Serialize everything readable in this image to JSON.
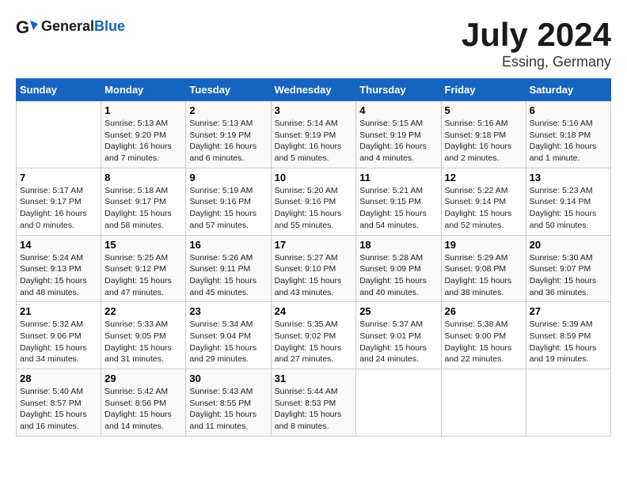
{
  "header": {
    "logo_text_general": "General",
    "logo_text_blue": "Blue",
    "month_title": "July 2024",
    "location": "Essing, Germany"
  },
  "calendar": {
    "days_of_week": [
      "Sunday",
      "Monday",
      "Tuesday",
      "Wednesday",
      "Thursday",
      "Friday",
      "Saturday"
    ],
    "weeks": [
      [
        {
          "day": "",
          "info": ""
        },
        {
          "day": "1",
          "info": "Sunrise: 5:13 AM\nSunset: 9:20 PM\nDaylight: 16 hours\nand 7 minutes."
        },
        {
          "day": "2",
          "info": "Sunrise: 5:13 AM\nSunset: 9:19 PM\nDaylight: 16 hours\nand 6 minutes."
        },
        {
          "day": "3",
          "info": "Sunrise: 5:14 AM\nSunset: 9:19 PM\nDaylight: 16 hours\nand 5 minutes."
        },
        {
          "day": "4",
          "info": "Sunrise: 5:15 AM\nSunset: 9:19 PM\nDaylight: 16 hours\nand 4 minutes."
        },
        {
          "day": "5",
          "info": "Sunrise: 5:16 AM\nSunset: 9:18 PM\nDaylight: 16 hours\nand 2 minutes."
        },
        {
          "day": "6",
          "info": "Sunrise: 5:16 AM\nSunset: 9:18 PM\nDaylight: 16 hours\nand 1 minute."
        }
      ],
      [
        {
          "day": "7",
          "info": "Sunrise: 5:17 AM\nSunset: 9:17 PM\nDaylight: 16 hours\nand 0 minutes."
        },
        {
          "day": "8",
          "info": "Sunrise: 5:18 AM\nSunset: 9:17 PM\nDaylight: 15 hours\nand 58 minutes."
        },
        {
          "day": "9",
          "info": "Sunrise: 5:19 AM\nSunset: 9:16 PM\nDaylight: 15 hours\nand 57 minutes."
        },
        {
          "day": "10",
          "info": "Sunrise: 5:20 AM\nSunset: 9:16 PM\nDaylight: 15 hours\nand 55 minutes."
        },
        {
          "day": "11",
          "info": "Sunrise: 5:21 AM\nSunset: 9:15 PM\nDaylight: 15 hours\nand 54 minutes."
        },
        {
          "day": "12",
          "info": "Sunrise: 5:22 AM\nSunset: 9:14 PM\nDaylight: 15 hours\nand 52 minutes."
        },
        {
          "day": "13",
          "info": "Sunrise: 5:23 AM\nSunset: 9:14 PM\nDaylight: 15 hours\nand 50 minutes."
        }
      ],
      [
        {
          "day": "14",
          "info": "Sunrise: 5:24 AM\nSunset: 9:13 PM\nDaylight: 15 hours\nand 48 minutes."
        },
        {
          "day": "15",
          "info": "Sunrise: 5:25 AM\nSunset: 9:12 PM\nDaylight: 15 hours\nand 47 minutes."
        },
        {
          "day": "16",
          "info": "Sunrise: 5:26 AM\nSunset: 9:11 PM\nDaylight: 15 hours\nand 45 minutes."
        },
        {
          "day": "17",
          "info": "Sunrise: 5:27 AM\nSunset: 9:10 PM\nDaylight: 15 hours\nand 43 minutes."
        },
        {
          "day": "18",
          "info": "Sunrise: 5:28 AM\nSunset: 9:09 PM\nDaylight: 15 hours\nand 40 minutes."
        },
        {
          "day": "19",
          "info": "Sunrise: 5:29 AM\nSunset: 9:08 PM\nDaylight: 15 hours\nand 38 minutes."
        },
        {
          "day": "20",
          "info": "Sunrise: 5:30 AM\nSunset: 9:07 PM\nDaylight: 15 hours\nand 36 minutes."
        }
      ],
      [
        {
          "day": "21",
          "info": "Sunrise: 5:32 AM\nSunset: 9:06 PM\nDaylight: 15 hours\nand 34 minutes."
        },
        {
          "day": "22",
          "info": "Sunrise: 5:33 AM\nSunset: 9:05 PM\nDaylight: 15 hours\nand 31 minutes."
        },
        {
          "day": "23",
          "info": "Sunrise: 5:34 AM\nSunset: 9:04 PM\nDaylight: 15 hours\nand 29 minutes."
        },
        {
          "day": "24",
          "info": "Sunrise: 5:35 AM\nSunset: 9:02 PM\nDaylight: 15 hours\nand 27 minutes."
        },
        {
          "day": "25",
          "info": "Sunrise: 5:37 AM\nSunset: 9:01 PM\nDaylight: 15 hours\nand 24 minutes."
        },
        {
          "day": "26",
          "info": "Sunrise: 5:38 AM\nSunset: 9:00 PM\nDaylight: 15 hours\nand 22 minutes."
        },
        {
          "day": "27",
          "info": "Sunrise: 5:39 AM\nSunset: 8:59 PM\nDaylight: 15 hours\nand 19 minutes."
        }
      ],
      [
        {
          "day": "28",
          "info": "Sunrise: 5:40 AM\nSunset: 8:57 PM\nDaylight: 15 hours\nand 16 minutes."
        },
        {
          "day": "29",
          "info": "Sunrise: 5:42 AM\nSunset: 8:56 PM\nDaylight: 15 hours\nand 14 minutes."
        },
        {
          "day": "30",
          "info": "Sunrise: 5:43 AM\nSunset: 8:55 PM\nDaylight: 15 hours\nand 11 minutes."
        },
        {
          "day": "31",
          "info": "Sunrise: 5:44 AM\nSunset: 8:53 PM\nDaylight: 15 hours\nand 8 minutes."
        },
        {
          "day": "",
          "info": ""
        },
        {
          "day": "",
          "info": ""
        },
        {
          "day": "",
          "info": ""
        }
      ]
    ]
  }
}
